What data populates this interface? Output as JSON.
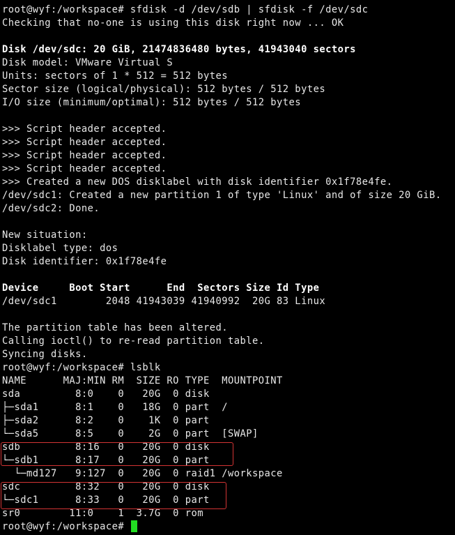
{
  "colors": {
    "background": "#000000",
    "foreground": "#e8e8e8",
    "bold_text": "#ffffff",
    "cursor": "#22dd22",
    "highlight_box": "#d43434"
  },
  "lines": [
    {
      "text": "root@wyf:/workspace# sfdisk -d /dev/sdb | sfdisk -f /dev/sdc",
      "name": "command-sfdisk"
    },
    {
      "text": "Checking that no-one is using this disk right now ... OK",
      "name": "output-line"
    },
    {
      "text": "",
      "name": "blank-line"
    },
    {
      "text": "Disk /dev/sdc: 20 GiB, 21474836480 bytes, 41943040 sectors",
      "name": "disk-summary",
      "bold": true
    },
    {
      "text": "Disk model: VMware Virtual S",
      "name": "output-line"
    },
    {
      "text": "Units: sectors of 1 * 512 = 512 bytes",
      "name": "output-line"
    },
    {
      "text": "Sector size (logical/physical): 512 bytes / 512 bytes",
      "name": "output-line"
    },
    {
      "text": "I/O size (minimum/optimal): 512 bytes / 512 bytes",
      "name": "output-line"
    },
    {
      "text": "",
      "name": "blank-line"
    },
    {
      "text": ">>> Script header accepted.",
      "name": "output-line"
    },
    {
      "text": ">>> Script header accepted.",
      "name": "output-line"
    },
    {
      "text": ">>> Script header accepted.",
      "name": "output-line"
    },
    {
      "text": ">>> Script header accepted.",
      "name": "output-line"
    },
    {
      "text": ">>> Created a new DOS disklabel with disk identifier 0x1f78e4fe.",
      "name": "output-line"
    },
    {
      "text": "/dev/sdc1: Created a new partition 1 of type 'Linux' and of size 20 GiB.",
      "name": "output-line"
    },
    {
      "text": "/dev/sdc2: Done.",
      "name": "output-line"
    },
    {
      "text": "",
      "name": "blank-line"
    },
    {
      "text": "New situation:",
      "name": "output-line"
    },
    {
      "text": "Disklabel type: dos",
      "name": "output-line"
    },
    {
      "text": "Disk identifier: 0x1f78e4fe",
      "name": "output-line"
    },
    {
      "text": "",
      "name": "blank-line"
    },
    {
      "text": "Device     Boot Start      End  Sectors Size Id Type",
      "name": "partition-table-header",
      "bold": true
    },
    {
      "text": "/dev/sdc1        2048 41943039 41940992  20G 83 Linux",
      "name": "partition-table-row"
    },
    {
      "text": "",
      "name": "blank-line"
    },
    {
      "text": "The partition table has been altered.",
      "name": "output-line"
    },
    {
      "text": "Calling ioctl() to re-read partition table.",
      "name": "output-line"
    },
    {
      "text": "Syncing disks.",
      "name": "output-line"
    },
    {
      "text": "root@wyf:/workspace# lsblk",
      "name": "command-lsblk"
    },
    {
      "text": "NAME      MAJ:MIN RM  SIZE RO TYPE  MOUNTPOINT",
      "name": "lsblk-header"
    },
    {
      "text": "sda         8:0    0   20G  0 disk",
      "name": "lsblk-row-sda"
    },
    {
      "text": "├─sda1      8:1    0   18G  0 part  /",
      "name": "lsblk-row-sda1"
    },
    {
      "text": "├─sda2      8:2    0    1K  0 part",
      "name": "lsblk-row-sda2"
    },
    {
      "text": "└─sda5      8:5    0    2G  0 part  [SWAP]",
      "name": "lsblk-row-sda5"
    },
    {
      "text": "sdb         8:16   0   20G  0 disk",
      "name": "lsblk-row-sdb"
    },
    {
      "text": "└─sdb1      8:17   0   20G  0 part",
      "name": "lsblk-row-sdb1"
    },
    {
      "text": "  └─md127   9:127  0   20G  0 raid1 /workspace",
      "name": "lsblk-row-md127"
    },
    {
      "text": "sdc         8:32   0   20G  0 disk",
      "name": "lsblk-row-sdc"
    },
    {
      "text": "└─sdc1      8:33   0   20G  0 part",
      "name": "lsblk-row-sdc1"
    },
    {
      "text": "sr0        11:0    1  3.7G  0 rom",
      "name": "lsblk-row-sr0"
    },
    {
      "text": "root@wyf:/workspace# ",
      "name": "shell-prompt",
      "cursor": true
    }
  ]
}
